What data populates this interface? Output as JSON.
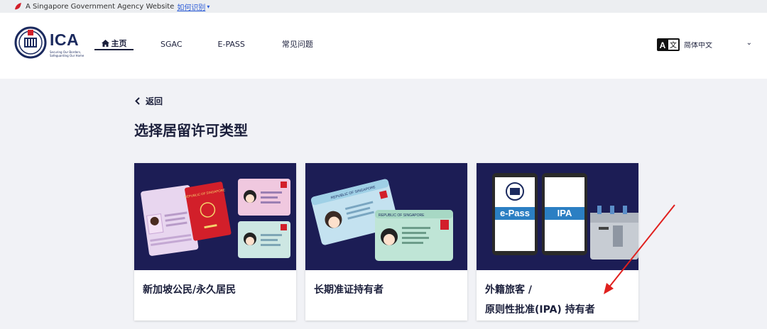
{
  "masthead": {
    "text": "A Singapore Government Agency Website",
    "link": "如何识别"
  },
  "logo": {
    "name": "ICA",
    "tagline": "Securing Our Borders, Safeguarding Our Home"
  },
  "nav": {
    "home": "主页",
    "sgac": "SGAC",
    "epass": "E-PASS",
    "faq": "常见问题"
  },
  "language": {
    "selected": "简体中文"
  },
  "main": {
    "back_label": "返回",
    "title": "选择居留许可类型"
  },
  "cards": [
    {
      "label": "新加坡公民/永久居民"
    },
    {
      "label": "长期准证持有者"
    },
    {
      "label_line1": "外籍旅客 /",
      "label_line2": "原则性批准(IPA) 持有者"
    }
  ],
  "illustrations": {
    "card1_passport": "REPUBLIC OF SINGAPORE",
    "card2_card": "REPUBLIC OF SINGAPORE",
    "card3_phone1": "e-Pass",
    "card3_phone2": "IPA"
  },
  "colors": {
    "navy": "#1c1d55",
    "accent_red": "#d21f2a",
    "annotation_red": "#e0201e"
  }
}
